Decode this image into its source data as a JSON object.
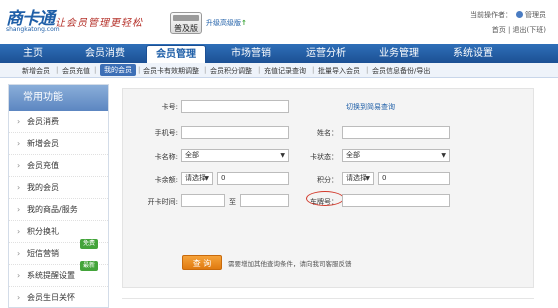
{
  "header": {
    "logo_text": "商卡通",
    "logo_domain": "shangkatong.com",
    "slogan": "让会员管理更轻松",
    "edition_label": "普及版",
    "upgrade_label": "升级高级版",
    "operator_prefix": "当前操作者：",
    "operator_name": "管理员",
    "home_link": "首页",
    "logout_link": "退出(下班)"
  },
  "nav": {
    "items": [
      "主页",
      "会员消费",
      "会员管理",
      "市场营销",
      "运营分析",
      "业务管理",
      "系统设置"
    ],
    "active": "会员管理"
  },
  "subnav": {
    "items": [
      "新增会员",
      "会员充值",
      "我的会员",
      "会员卡有效期调整",
      "会员积分调整",
      "充值记录查询",
      "批量导入会员",
      "会员信息备份/导出"
    ],
    "active": "我的会员"
  },
  "sidebar": {
    "title": "常用功能",
    "items": [
      {
        "label": "会员消费"
      },
      {
        "label": "新增会员"
      },
      {
        "label": "会员充值"
      },
      {
        "label": "我的会员"
      },
      {
        "label": "我的商品/服务"
      },
      {
        "label": "积分换礼"
      },
      {
        "label": "短信营销",
        "badge": "免费"
      },
      {
        "label": "系统提醒设置",
        "badge": "最新"
      },
      {
        "label": "会员生日关怀"
      }
    ]
  },
  "form": {
    "card_no_label": "卡号:",
    "switch_link": "切换到简易查询",
    "phone_label": "手机号:",
    "name_label": "姓名：",
    "card_name_label": "卡名称:",
    "card_name_value": "全部",
    "card_status_label": "卡状态：",
    "card_status_value": "全部",
    "balance_label": "卡余额:",
    "balance_select": "请选择",
    "balance_value": "0",
    "points_label": "积分：",
    "points_select": "请选择",
    "points_value": "0",
    "open_time_label": "开卡时间:",
    "range_to": "至",
    "plate_label": "车牌号：",
    "query_button": "查 询",
    "hint": "需要增加其他查询条件，请向我司客服反馈"
  },
  "colors": {
    "brand_blue": "#1f5fa8",
    "nav_blue": "#1c5094",
    "query_orange": "#e07a10",
    "highlight_red": "#d23a2c",
    "badge_green": "#43a43a"
  }
}
